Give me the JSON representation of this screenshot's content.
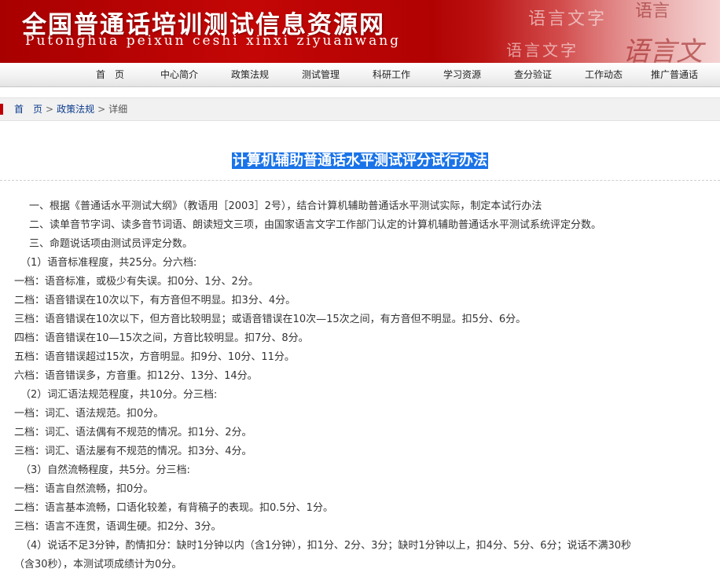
{
  "header": {
    "title": "全国普通话培训测试信息资源网",
    "subtitle": "Putonghua peixun ceshi xinxi ziyuanwang",
    "watermark": {
      "text1": "语言文字",
      "text2": "语言",
      "text3": "语言文字",
      "text4": "语言文"
    }
  },
  "nav": {
    "items": [
      "首　页",
      "中心简介",
      "政策法规",
      "测试管理",
      "科研工作",
      "学习资源",
      "查分验证",
      "工作动态",
      "推广普通话"
    ]
  },
  "breadcrumb": {
    "home": "首　页",
    "sep1": ">",
    "section": "政策法规",
    "sep2": ">",
    "current": "详细"
  },
  "article": {
    "title": "计算机辅助普通话水平测试评分试行办法",
    "lines": [
      "一、根据《普通话水平测试大纲》（教语用［2003］2号），结合计算机辅助普通话水平测试实际，制定本试行办法",
      "二、读单音节字词、读多音节词语、朗读短文三项，由国家语言文字工作部门认定的计算机辅助普通话水平测试系统评定分数。",
      "三、命题说话项由测试员评定分数。",
      "（1）语音标准程度，共25分。分六档:",
      "一档：语音标准，或极少有失误。扣0分、1分、2分。",
      "二档：语音错误在10次以下，有方音但不明显。扣3分、4分。",
      "三档：语音错误在10次以下，但方音比较明显；或语音错误在10次—15次之间，有方音但不明显。扣5分、6分。",
      "四档：语音错误在10—15次之间，方音比较明显。扣7分、8分。",
      "五档：语音错误超过15次，方音明显。扣9分、10分、11分。",
      "六档：语音错误多，方音重。扣12分、13分、14分。",
      "（2）词汇语法规范程度，共10分。分三档:",
      "一档：词汇、语法规范。扣0分。",
      "二档：词汇、语法偶有不规范的情况。扣1分、2分。",
      "三档：词汇、语法屡有不规范的情况。扣3分、4分。",
      "（3）自然流畅程度，共5分。分三档:",
      "一档：语言自然流畅，扣0分。",
      "二档：语言基本流畅，口语化较差，有背稿子的表现。扣0.5分、1分。",
      "三档：语言不连贯，语调生硬。扣2分、3分。",
      "（4）说话不足3分钟，酌情扣分：缺时1分钟以内（含1分钟），扣1分、2分、3分；缺时1分钟以上，扣4分、5分、6分；说话不满30秒",
      "（含30秒），本测试项成绩计为0分。"
    ]
  }
}
